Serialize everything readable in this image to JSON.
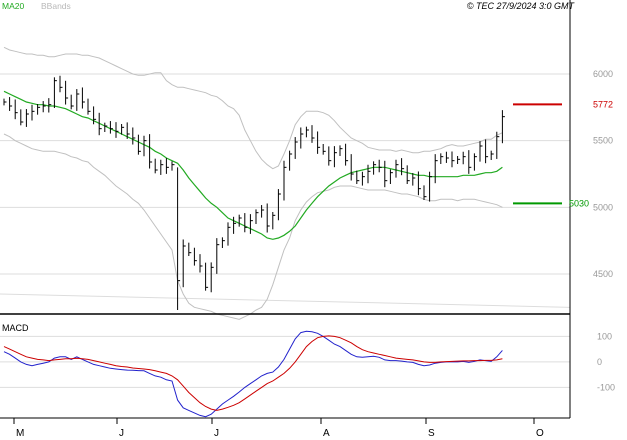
{
  "header": {
    "legend_ma": "MA20",
    "legend_bb": "BBands",
    "copyright": "© TEC 27/9/2024 3:0 GMT"
  },
  "colors": {
    "price": "#000000",
    "ma": "#22aa22",
    "bbands": "#c0c0c0",
    "grid": "#dddddd",
    "resistance": "#cc0000",
    "support": "#009900",
    "macd": "#2222cc",
    "signal": "#cc0000",
    "axis": "#000000"
  },
  "chart_data": [
    {
      "type": "ohlc",
      "name": "price",
      "x_months": [
        "M",
        "J",
        "J",
        "A",
        "S",
        "O"
      ],
      "ylim": [
        4200,
        6450
      ],
      "y_ticks": [
        4500,
        5000,
        5500,
        6000
      ],
      "grid": true,
      "levels": [
        {
          "label": "5772",
          "value": 5772,
          "kind": "resistance"
        },
        {
          "label": "5030",
          "value": 5030,
          "kind": "support"
        }
      ],
      "closes": [
        5790,
        5760,
        5710,
        5640,
        5700,
        5720,
        5750,
        5760,
        5770,
        5950,
        5900,
        5820,
        5760,
        5850,
        5790,
        5720,
        5660,
        5590,
        5610,
        5590,
        5570,
        5600,
        5550,
        5520,
        5420,
        5500,
        5340,
        5280,
        5320,
        5300,
        5320,
        4450,
        4710,
        4660,
        4600,
        4560,
        4400,
        4550,
        4720,
        4750,
        4850,
        4880,
        4920,
        4850,
        4900,
        4960,
        4980,
        4860,
        4940,
        5100,
        5300,
        5400,
        5490,
        5550,
        5580,
        5520,
        5450,
        5420,
        5350,
        5410,
        5440,
        5350,
        5250,
        5200,
        5230,
        5270,
        5320,
        5300,
        5200,
        5260,
        5320,
        5290,
        5200,
        5220,
        5140,
        5080,
        5230,
        5350,
        5380,
        5370,
        5350,
        5360,
        5380,
        5300,
        5380,
        5460,
        5380,
        5400,
        5530,
        5680
      ],
      "ma20": [
        5870,
        5850,
        5830,
        5810,
        5790,
        5780,
        5770,
        5770,
        5760,
        5760,
        5750,
        5740,
        5720,
        5700,
        5680,
        5670,
        5650,
        5630,
        5610,
        5590,
        5570,
        5550,
        5530,
        5510,
        5490,
        5470,
        5450,
        5420,
        5400,
        5370,
        5350,
        5330,
        5280,
        5220,
        5170,
        5120,
        5070,
        5030,
        5000,
        4960,
        4920,
        4900,
        4880,
        4860,
        4840,
        4820,
        4800,
        4770,
        4760,
        4770,
        4790,
        4820,
        4860,
        4920,
        4980,
        5030,
        5080,
        5120,
        5160,
        5190,
        5220,
        5240,
        5260,
        5270,
        5280,
        5290,
        5300,
        5300,
        5300,
        5290,
        5280,
        5270,
        5260,
        5250,
        5240,
        5240,
        5230,
        5230,
        5230,
        5230,
        5230,
        5230,
        5240,
        5240,
        5240,
        5250,
        5260,
        5260,
        5270,
        5300
      ],
      "bb_upper": [
        6200,
        6180,
        6170,
        6160,
        6150,
        6150,
        6140,
        6140,
        6130,
        6130,
        6140,
        6150,
        6150,
        6150,
        6140,
        6140,
        6130,
        6120,
        6100,
        6080,
        6060,
        6040,
        6020,
        6000,
        5990,
        5990,
        6000,
        6010,
        6010,
        5950,
        5920,
        5900,
        5900,
        5890,
        5880,
        5870,
        5860,
        5840,
        5830,
        5800,
        5760,
        5740,
        5690,
        5580,
        5500,
        5420,
        5360,
        5320,
        5290,
        5310,
        5400,
        5500,
        5620,
        5680,
        5720,
        5720,
        5720,
        5710,
        5690,
        5650,
        5600,
        5560,
        5520,
        5500,
        5480,
        5450,
        5440,
        5430,
        5430,
        5430,
        5420,
        5430,
        5420,
        5410,
        5410,
        5420,
        5420,
        5430,
        5440,
        5460,
        5470,
        5460,
        5460,
        5470,
        5480,
        5490,
        5510,
        5510,
        5540,
        5560
      ],
      "bb_lower": [
        5550,
        5530,
        5500,
        5480,
        5460,
        5440,
        5430,
        5420,
        5420,
        5420,
        5410,
        5400,
        5380,
        5370,
        5350,
        5340,
        5300,
        5270,
        5240,
        5200,
        5160,
        5130,
        5100,
        5060,
        5030,
        4980,
        4920,
        4860,
        4800,
        4740,
        4680,
        4450,
        4350,
        4280,
        4250,
        4240,
        4230,
        4220,
        4200,
        4190,
        4180,
        4170,
        4160,
        4180,
        4200,
        4230,
        4250,
        4310,
        4420,
        4550,
        4680,
        4770,
        4900,
        4980,
        5040,
        5080,
        5110,
        5120,
        5130,
        5150,
        5160,
        5160,
        5160,
        5150,
        5140,
        5130,
        5130,
        5130,
        5130,
        5120,
        5110,
        5100,
        5100,
        5090,
        5080,
        5060,
        5050,
        5050,
        5060,
        5060,
        5060,
        5050,
        5060,
        5060,
        5060,
        5050,
        5040,
        5030,
        5020,
        5000
      ]
    },
    {
      "type": "line",
      "name": "MACD",
      "x_months": [
        "M",
        "J",
        "J",
        "A",
        "S",
        "O"
      ],
      "ylim": [
        -220,
        180
      ],
      "y_ticks": [
        100,
        0,
        -100
      ],
      "y_tick_labels": [
        "100",
        "0",
        "-100"
      ],
      "series": [
        {
          "name": "MACD",
          "role": "macd",
          "values": [
            40,
            30,
            15,
            0,
            -10,
            -15,
            -10,
            -5,
            0,
            15,
            20,
            20,
            10,
            20,
            10,
            0,
            -10,
            -15,
            -20,
            -25,
            -28,
            -30,
            -32,
            -33,
            -34,
            -35,
            -45,
            -55,
            -60,
            -70,
            -75,
            -150,
            -180,
            -190,
            -200,
            -210,
            -215,
            -205,
            -185,
            -165,
            -150,
            -135,
            -118,
            -100,
            -85,
            -70,
            -55,
            -45,
            -40,
            -20,
            10,
            50,
            90,
            115,
            120,
            118,
            112,
            100,
            85,
            70,
            60,
            45,
            30,
            20,
            18,
            20,
            22,
            18,
            8,
            5,
            5,
            3,
            0,
            -2,
            -10,
            -15,
            -12,
            -5,
            -2,
            0,
            0,
            0,
            2,
            -2,
            2,
            8,
            5,
            2,
            20,
            45
          ]
        },
        {
          "name": "Signal",
          "role": "signal",
          "values": [
            60,
            50,
            40,
            30,
            20,
            15,
            10,
            8,
            5,
            8,
            10,
            12,
            12,
            14,
            12,
            10,
            5,
            0,
            -5,
            -10,
            -15,
            -18,
            -20,
            -24,
            -26,
            -28,
            -30,
            -35,
            -40,
            -45,
            -55,
            -70,
            -95,
            -120,
            -140,
            -160,
            -175,
            -185,
            -190,
            -185,
            -178,
            -170,
            -160,
            -145,
            -130,
            -115,
            -100,
            -85,
            -75,
            -60,
            -45,
            -25,
            0,
            30,
            60,
            80,
            95,
            100,
            102,
            100,
            95,
            85,
            75,
            60,
            48,
            40,
            35,
            30,
            25,
            20,
            15,
            12,
            10,
            8,
            4,
            0,
            -2,
            -2,
            0,
            1,
            2,
            3,
            4,
            4,
            5,
            5,
            6,
            6,
            8,
            12
          ]
        }
      ]
    }
  ]
}
